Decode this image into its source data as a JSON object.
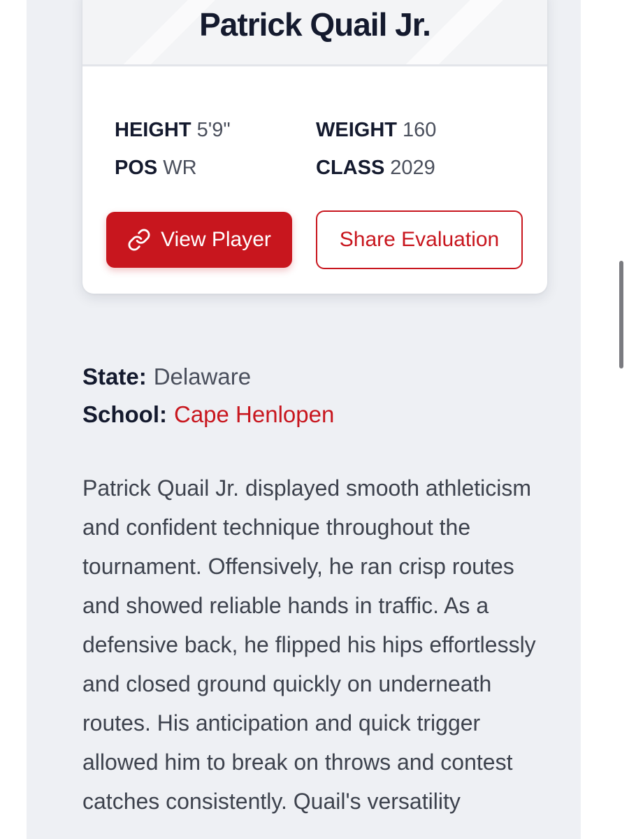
{
  "player": {
    "name": "Patrick Quail Jr."
  },
  "stats": {
    "height": {
      "label": "HEIGHT",
      "value": "5'9\""
    },
    "weight": {
      "label": "WEIGHT",
      "value": "160"
    },
    "position": {
      "label": "POS",
      "value": "WR"
    },
    "class": {
      "label": "CLASS",
      "value": "2029"
    }
  },
  "actions": {
    "view_player_label": "View Player",
    "view_player_icon": "link-icon",
    "share_label": "Share Evaluation"
  },
  "info": {
    "state_label": "State:",
    "state_value": "Delaware",
    "school_label": "School:",
    "school_value": "Cape Henlopen"
  },
  "evaluation": {
    "text": "Patrick Quail Jr. displayed smooth athleticism and confident technique throughout the tournament. Offensively, he ran crisp routes and showed reliable hands in traffic. As a defensive back, he flipped his hips effortlessly and closed ground quickly on underneath routes. His anticipation and quick trigger allowed him to break on throws and contest catches consistently. Quail's versatility"
  },
  "colors": {
    "accent": "#c8161e",
    "heading": "#141a2e",
    "body_text": "#3d424d",
    "background": "#eef0f4"
  }
}
